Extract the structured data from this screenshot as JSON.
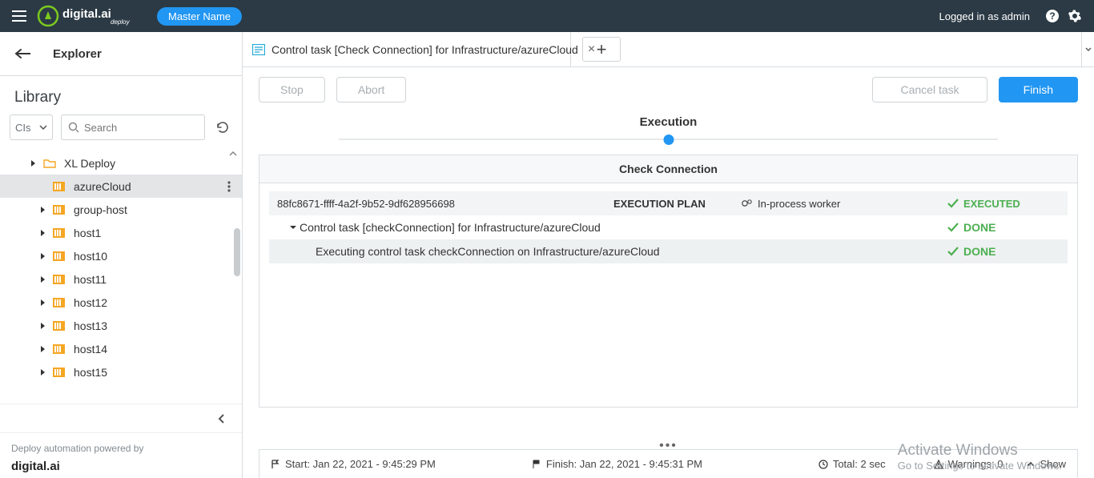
{
  "header": {
    "brand_text": "digital.ai",
    "brand_sub": "deploy",
    "master_badge": "Master Name",
    "login": "Logged in as admin"
  },
  "sidebar": {
    "explorer": "Explorer",
    "library": "Library",
    "ci_select": "CIs",
    "search_placeholder": "Search",
    "items": [
      {
        "label": "XL Deploy",
        "type": "folder",
        "selected": false
      },
      {
        "label": "azureCloud",
        "type": "host-orange",
        "selected": true,
        "no_caret": true,
        "menu": true
      },
      {
        "label": "group-host",
        "type": "host-orange",
        "selected": false
      },
      {
        "label": "host1",
        "type": "host-orange",
        "selected": false
      },
      {
        "label": "host10",
        "type": "host-orange",
        "selected": false
      },
      {
        "label": "host11",
        "type": "host-orange",
        "selected": false
      },
      {
        "label": "host12",
        "type": "host-orange",
        "selected": false
      },
      {
        "label": "host13",
        "type": "host-orange",
        "selected": false
      },
      {
        "label": "host14",
        "type": "host-orange",
        "selected": false
      },
      {
        "label": "host15",
        "type": "host-orange",
        "selected": false
      }
    ],
    "footer_line": "Deploy automation powered by",
    "footer_brand": "digital.ai"
  },
  "tabs": {
    "active_label": "Control task [Check Connection] for Infrastructure/azureCloud"
  },
  "actions": {
    "stop": "Stop",
    "abort": "Abort",
    "cancel": "Cancel task",
    "finish": "Finish"
  },
  "execution": {
    "label": "Execution",
    "panel": "Check Connection",
    "plan_id": "88fc8671-ffff-4a2f-9b52-9df628956698",
    "plan_label": "EXECUTION PLAN",
    "worker": "In-process worker",
    "status": "EXECUTED",
    "row1": "Control task [checkConnection] for Infrastructure/azureCloud",
    "row1_status": "DONE",
    "row2": "Executing control task checkConnection on Infrastructure/azureCloud",
    "row2_status": "DONE"
  },
  "status": {
    "start": "Start: Jan 22, 2021 - 9:45:29 PM",
    "finish": "Finish: Jan 22, 2021 - 9:45:31 PM",
    "total": "Total: 2 sec",
    "warnings": "Warnings: 0",
    "show": "Show"
  },
  "watermark": {
    "l1": "Activate Windows",
    "l2": "Go to Settings to activate Windows."
  }
}
